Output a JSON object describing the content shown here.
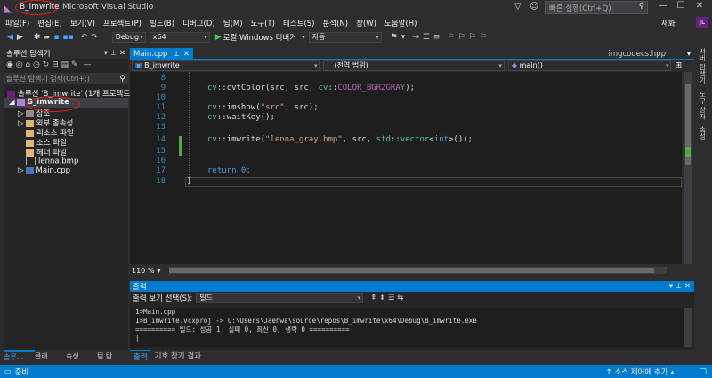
{
  "titlebar": {
    "logo": "◣",
    "project": "B_imwrite",
    "app_title": "Microsoft Visual Studio",
    "quick_launch_placeholder": "빠른 실행(Ctrl+Q)",
    "filter_icon": "filter-icon",
    "min": "—",
    "max": "☐",
    "close": "✕"
  },
  "menu": {
    "items": [
      "파일(F)",
      "편집(E)",
      "보기(V)",
      "프로젝트(P)",
      "빌드(B)",
      "디버그(D)",
      "팀(M)",
      "도구(T)",
      "테스트(S)",
      "분석(N)",
      "창(W)",
      "도움말(H)"
    ],
    "right_label": "재화",
    "avatar_initials": "JL"
  },
  "toolbar": {
    "config": "Debug",
    "platform": "x64",
    "run_label": "로컬 Windows 디버거",
    "run_mode": "자동"
  },
  "solution": {
    "header": "솔루션 탐색기",
    "search_placeholder": "솔루션 탐색기 검색(Ctrl+;)",
    "items": [
      {
        "label": "솔루션 'B_imwrite' (1개 프로젝트)",
        "indent": 0,
        "icon": "solution-icon"
      },
      {
        "label": "B_imwrite",
        "indent": 1,
        "icon": "project-icon"
      },
      {
        "label": "참조",
        "indent": 2,
        "icon": "references-icon"
      },
      {
        "label": "외부 종속성",
        "indent": 2,
        "icon": "folder-icon"
      },
      {
        "label": "리소스 파일",
        "indent": 2,
        "icon": "folder-icon"
      },
      {
        "label": "소스 파일",
        "indent": 2,
        "icon": "folder-icon"
      },
      {
        "label": "헤더 파일",
        "indent": 2,
        "icon": "folder-icon"
      },
      {
        "label": "lenna.bmp",
        "indent": 2,
        "icon": "image-file-icon"
      },
      {
        "label": "Main.cpp",
        "indent": 2,
        "icon": "cpp-file-icon"
      }
    ],
    "bottom_tabs": [
      "솔루...",
      "클래...",
      "속성...",
      "팀 탐..."
    ]
  },
  "editor": {
    "tab_active": "Main.cpp",
    "tab_right": "imgcodecs.hpp",
    "nav_project": "B_imwrite",
    "nav_scope": "(전역 범위)",
    "nav_member": "main()",
    "zoom": "110 %",
    "lines": [
      {
        "n": "8",
        "text": ""
      },
      {
        "n": "9",
        "text": "cv::cvtColor(src, src, cv::COLOR_BGR2GRAY);"
      },
      {
        "n": "10",
        "text": ""
      },
      {
        "n": "11",
        "text": "cv::imshow(\"src\", src);"
      },
      {
        "n": "12",
        "text": "cv::waitKey();"
      },
      {
        "n": "13",
        "text": ""
      },
      {
        "n": "14",
        "text": "cv::imwrite(\"lenna_gray.bmp\", src, std::vector<int>());"
      },
      {
        "n": "15",
        "text": ""
      },
      {
        "n": "16",
        "text": ""
      },
      {
        "n": "17",
        "text": "return 0;"
      },
      {
        "n": "18",
        "text": "}"
      }
    ]
  },
  "right_sidebar": [
    "서버 탐색기",
    "도구 상자",
    "속성"
  ],
  "output": {
    "title": "출력",
    "source_label": "출력 보기 선택(S):",
    "source_value": "빌드",
    "lines": [
      "1>Main.cpp",
      "1>B_imwrite.vcxproj -> C:\\Users\\Jaehwa\\source\\repos\\B_imwrite\\x64\\Debug\\B_imwrite.exe",
      "========== 빌드: 성공 1, 실패 0, 최신 0, 생략 0 =========="
    ],
    "tabs": [
      "출력",
      "기호 찾기 결과"
    ]
  },
  "status": {
    "left": "준비",
    "right": "↑ 소스 제어에 추가 ▴"
  },
  "colors": {
    "accent": "#007acc",
    "background": "#2d2d30",
    "editor_bg": "#1e1e1e",
    "annotation": "#e01f1f"
  }
}
